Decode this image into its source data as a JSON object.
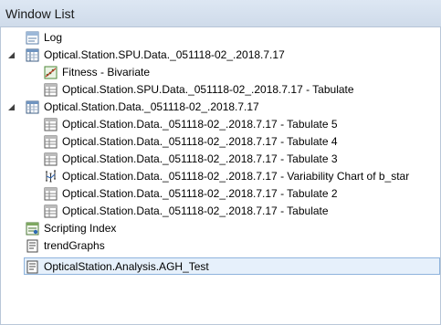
{
  "window": {
    "title": "Window List"
  },
  "tree": {
    "items": [
      {
        "label": "Log",
        "icon": "log-icon",
        "level": 1
      },
      {
        "label": "Optical.Station.SPU.Data._051118-02_.2018.7.17",
        "icon": "data-table-icon",
        "level": 0,
        "expanded": true
      },
      {
        "label": "Fitness - Bivariate",
        "icon": "fit-model-icon",
        "level": 2
      },
      {
        "label": "Optical.Station.SPU.Data._051118-02_.2018.7.17 - Tabulate",
        "icon": "tabulate-icon",
        "level": 2
      },
      {
        "label": "Optical.Station.Data._051118-02_.2018.7.17",
        "icon": "data-table-icon",
        "level": 0,
        "expanded": true
      },
      {
        "label": "Optical.Station.Data._051118-02_.2018.7.17 - Tabulate 5",
        "icon": "tabulate-icon",
        "level": 2
      },
      {
        "label": "Optical.Station.Data._051118-02_.2018.7.17 - Tabulate 4",
        "icon": "tabulate-icon",
        "level": 2
      },
      {
        "label": "Optical.Station.Data._051118-02_.2018.7.17 - Tabulate 3",
        "icon": "tabulate-icon",
        "level": 2
      },
      {
        "label": "Optical.Station.Data._051118-02_.2018.7.17 - Variability Chart of b_star",
        "icon": "variability-chart-icon",
        "level": 2
      },
      {
        "label": "Optical.Station.Data._051118-02_.2018.7.17 - Tabulate 2",
        "icon": "tabulate-icon",
        "level": 2
      },
      {
        "label": "Optical.Station.Data._051118-02_.2018.7.17 - Tabulate",
        "icon": "tabulate-icon",
        "level": 2
      },
      {
        "label": "Scripting Index",
        "icon": "scripting-index-icon",
        "level": 1
      },
      {
        "label": "trendGraphs",
        "icon": "script-icon",
        "level": 1
      },
      {
        "label": "OpticalStation.Analysis.AGH_Test",
        "icon": "script-icon",
        "level": 1,
        "selected": true
      }
    ]
  },
  "colors": {
    "selection_bg": "#e6f0fb",
    "selection_border": "#8fb4dd",
    "titlebar": "#d6e1ee"
  }
}
